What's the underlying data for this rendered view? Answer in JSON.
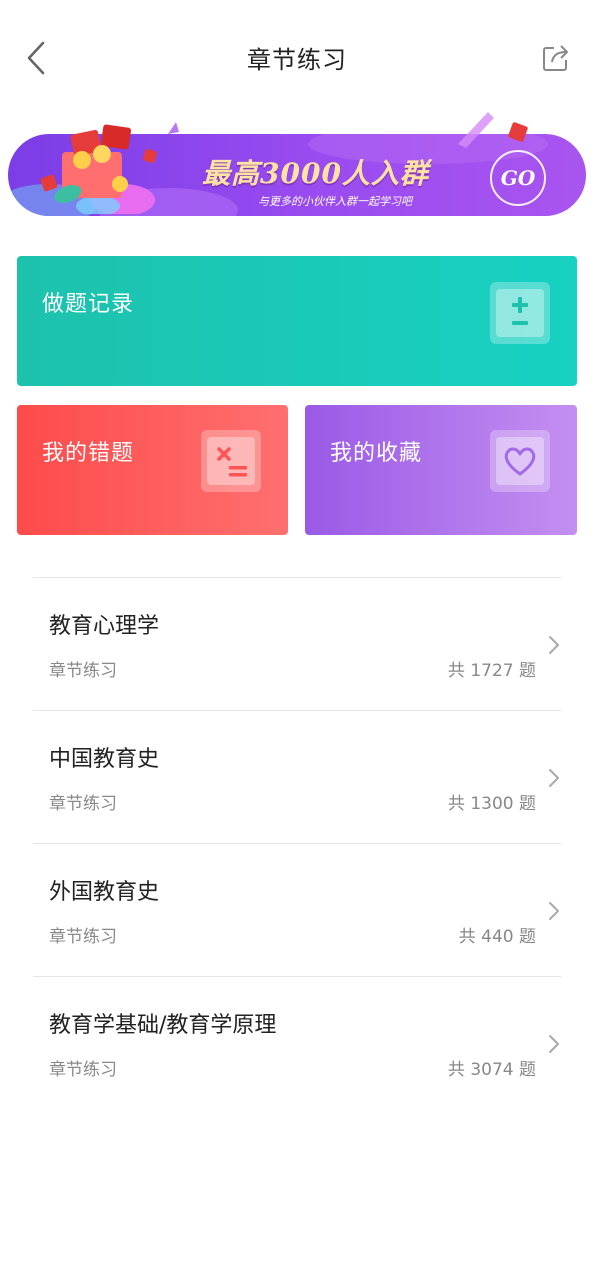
{
  "header": {
    "title": "章节练习",
    "back_icon": "chevron-left-icon",
    "share_icon": "share-icon"
  },
  "banner": {
    "title": "最高3000人入群",
    "subtitle": "与更多的小伙伴入群一起学习吧",
    "go_label": "GO"
  },
  "cards": {
    "history": {
      "label": "做题记录",
      "icon": "plus-minus-icon",
      "color": "#1cc8b6"
    },
    "wrong": {
      "label": "我的错题",
      "icon": "wrong-answer-icon",
      "color": "#ff5656"
    },
    "favorites": {
      "label": "我的收藏",
      "icon": "heart-icon",
      "color": "#b07ceb"
    }
  },
  "subjects": [
    {
      "title": "教育心理学",
      "subtitle": "章节练习",
      "count": "共 1727 题"
    },
    {
      "title": "中国教育史",
      "subtitle": "章节练习",
      "count": "共 1300 题"
    },
    {
      "title": "外国教育史",
      "subtitle": "章节练习",
      "count": "共 440 题"
    },
    {
      "title": "教育学基础/教育学原理",
      "subtitle": "章节练习",
      "count": "共 3074 题"
    }
  ]
}
